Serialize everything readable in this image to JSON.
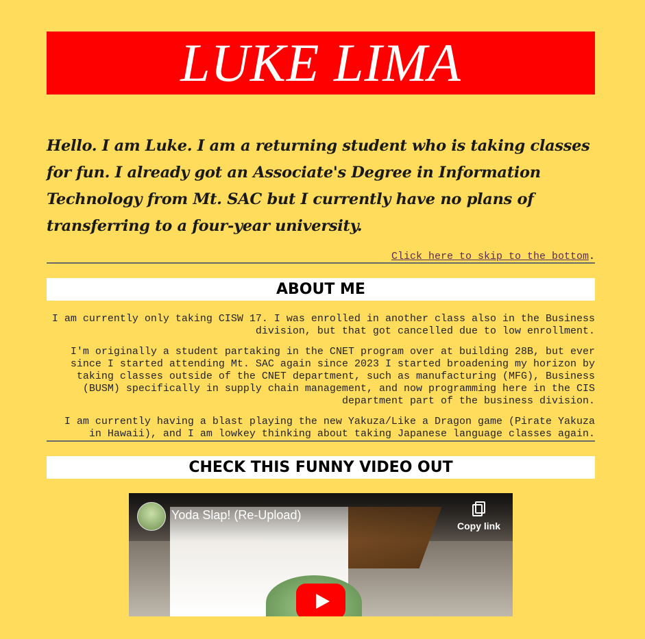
{
  "header": {
    "name": "LUKE LIMA"
  },
  "intro": {
    "text": "Hello. I am Luke. I am a returning student who is taking classes for fun. I already got an Associate's Degree in Information Technology from Mt. SAC but I currently have no plans of transferring to a four-year university."
  },
  "skip": {
    "link_text": "Click here to skip to the bottom",
    "suffix": "."
  },
  "about": {
    "title": "ABOUT ME",
    "paragraphs": [
      "I am currently only taking CISW 17. I was enrolled in another class also in the Business division, but that got cancelled due to low enrollment.",
      "I'm originally a student partaking in the CNET program over at building 28B, but ever since I started attending Mt. SAC again since 2023 I started broadening my horizon by taking classes outside of the CNET department, such as manufacturing (MFG), Business (BUSM) specifically in supply chain management, and now programming here in the CIS department part of the business division.",
      "I am currently having a blast playing the new Yakuza/Like a Dragon game (Pirate Yakuza in Hawaii), and I am lowkey thinking about taking Japanese language classes again."
    ]
  },
  "video_section": {
    "title": "CHECK THIS FUNNY VIDEO OUT",
    "video_title": "Yoda Slap! (Re-Upload)",
    "copy_label": "Copy link",
    "icons": {
      "channel": "yoda-avatar-icon",
      "copy": "copy-link-icon",
      "play": "play-icon"
    }
  },
  "colors": {
    "background": "#ffdc5c",
    "banner": "#ff0000",
    "play": "#ff0000"
  }
}
